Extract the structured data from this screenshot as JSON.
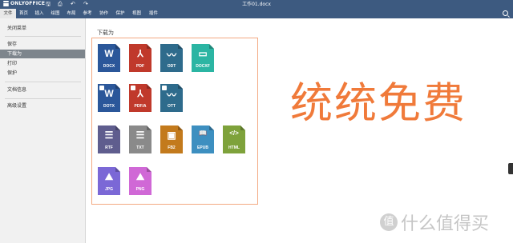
{
  "titlebar": {
    "logo_text": "ONLYOFFICE",
    "document_title": "工作01.docx",
    "quick_actions": [
      {
        "name": "save-icon",
        "glyph": "🖫"
      },
      {
        "name": "print-icon",
        "glyph": "⎙"
      },
      {
        "name": "undo-icon",
        "glyph": "↶"
      },
      {
        "name": "redo-icon",
        "glyph": "↷"
      }
    ]
  },
  "menubar": {
    "tabs": [
      "文件",
      "首页",
      "插入",
      "绘图",
      "布局",
      "参考",
      "协作",
      "保护",
      "视图",
      "插件"
    ],
    "active_tab": "文件"
  },
  "sidebar": {
    "items": [
      {
        "label": "关闭菜单"
      },
      {
        "label": "保存"
      },
      {
        "label": "下载为",
        "selected": true
      },
      {
        "label": "打印"
      },
      {
        "label": "保护"
      },
      {
        "label": "文档信息"
      },
      {
        "label": "高级设置"
      }
    ]
  },
  "panel": {
    "title": "下载为",
    "formats": [
      {
        "label": "DOCX",
        "glyph": "W",
        "color": "#2b579a",
        "template": false
      },
      {
        "label": "PDF",
        "glyph": "⅄",
        "color": "#c0392b",
        "template": false
      },
      {
        "label": "ODT",
        "glyph": "〰",
        "color": "#2e6b8c",
        "template": false
      },
      {
        "label": "DOCXF",
        "glyph": "▭",
        "color": "#2bb5a3",
        "template": false
      },
      {
        "label": "DOTX",
        "glyph": "W",
        "color": "#2b579a",
        "template": true
      },
      {
        "label": "PDF/A",
        "glyph": "⅄",
        "color": "#c0392b",
        "template": true
      },
      {
        "label": "OTT",
        "glyph": "〰",
        "color": "#2e6b8c",
        "template": true
      },
      {
        "label": "RTF",
        "glyph": "☰",
        "color": "#5f5d8e",
        "template": false
      },
      {
        "label": "TXT",
        "glyph": "☰",
        "color": "#8a8a8a",
        "template": false
      },
      {
        "label": "FB2",
        "glyph": "▣",
        "color": "#c37a1c",
        "template": false
      },
      {
        "label": "EPUB",
        "glyph": "📖",
        "color": "#3d8fc0",
        "template": false
      },
      {
        "label": "HTML",
        "glyph": "</>",
        "color": "#7ea23b",
        "template": false
      },
      {
        "label": "JPG",
        "glyph": "⛰",
        "color": "#7b68d6",
        "template": false
      },
      {
        "label": "PNG",
        "glyph": "⛰",
        "color": "#d068d6",
        "template": false
      }
    ]
  },
  "overlay": {
    "promo_text": "统统免费",
    "watermark_badge": "值",
    "watermark_text": "什么值得买"
  }
}
